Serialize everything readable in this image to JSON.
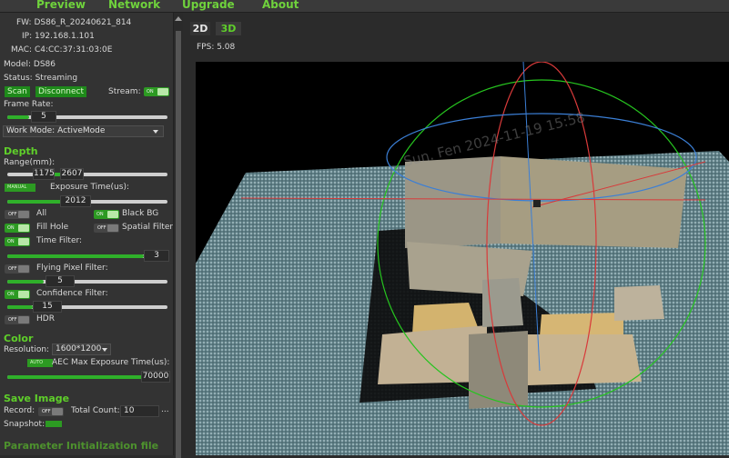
{
  "menu": {
    "items": [
      "Preview",
      "Network",
      "Upgrade",
      "About"
    ]
  },
  "device": {
    "fw": "FW: DS86_R_20240621_814",
    "ip": "IP: 192.168.1.101",
    "mac": "MAC: C4:CC:37:31:03:0E",
    "model": "Model: DS86",
    "status": "Status: Streaming"
  },
  "controls": {
    "scan_label": "Scan",
    "disconnect_label": "Disconnect",
    "stream_label": "Stream:",
    "frame_rate_label": "Frame Rate:",
    "frame_rate_value": "5",
    "work_mode": "Work Mode: ActiveMode"
  },
  "depth": {
    "title": "Depth",
    "range_label": "Range(mm):",
    "range_min": "1175",
    "range_max": "2607",
    "exposure_label": "Exposure Time(us):",
    "exposure_value": "2012",
    "all_label": "All",
    "black_bg_label": "Black BG",
    "fill_hole_label": "Fill Hole",
    "spatial_filter_label": "Spatial Filter",
    "time_filter_label": "Time Filter:",
    "time_filter_value": "3",
    "flying_pixel_label": "Flying Pixel Filter:",
    "flying_pixel_value": "5",
    "confidence_label": "Confidence Filter:",
    "confidence_value": "15",
    "hdr_label": "HDR"
  },
  "color": {
    "title": "Color",
    "resolution_label": "Resolution:",
    "resolution_value": "1600*1200",
    "aec_label": "AEC Max Exposure Time(us):",
    "aec_value": "70000"
  },
  "save": {
    "title": "Save Image",
    "record_label": "Record:",
    "total_count_label": "Total Count:",
    "total_count_value": "10",
    "ellipsis": "...",
    "snapshot_label": "Snapshot:"
  },
  "param_init": "Parameter Initialization file",
  "toggle_text": {
    "on": "ON",
    "off": "OFF",
    "manual": "MANUAL",
    "auto": "AUTO"
  },
  "viewer": {
    "tab_2d": "2D",
    "tab_3d": "3D",
    "fps": "FPS: 5.08",
    "watermark": "Sun. Fen 2024-11-19 15:58"
  },
  "colors": {
    "accent": "#5fd02a",
    "button_green": "#1e8a1a",
    "panel_bg": "#333333",
    "viewport_bg": "#000000"
  }
}
